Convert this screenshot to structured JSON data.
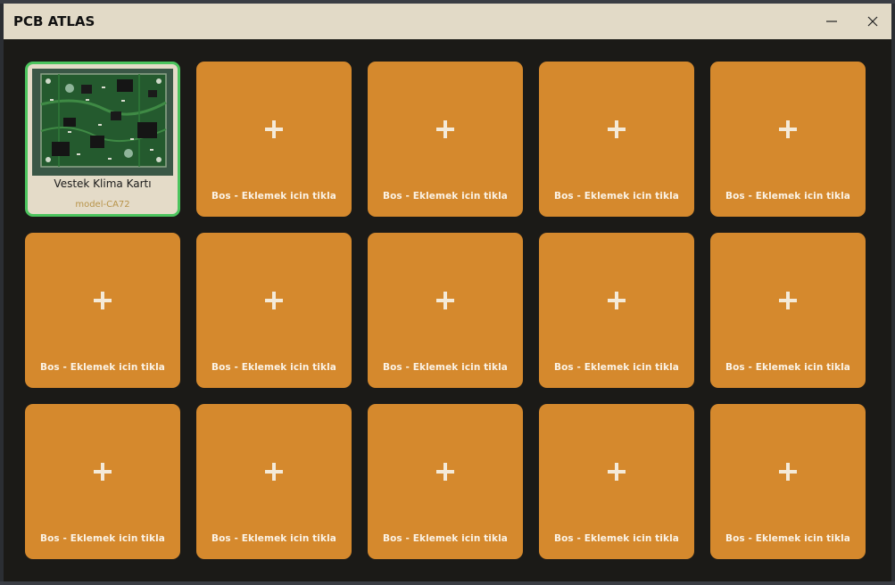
{
  "window": {
    "title": "PCB ATLAS",
    "minimize_icon": "minimize-icon",
    "close_icon": "close-icon"
  },
  "colors": {
    "titlebar": "#e2dac7",
    "background": "#1b1a17",
    "tile_empty": "#d5892d",
    "tile_filled": "#e4dbc8",
    "selected_border": "#4cc45e"
  },
  "cards": [
    {
      "filled": true,
      "name": "Vestek Klima Kartı",
      "model": "model-CA72",
      "image_icon": "pcb-board-image"
    },
    {
      "filled": false,
      "label": "Bos - Eklemek icin tikla"
    },
    {
      "filled": false,
      "label": "Bos - Eklemek icin tikla"
    },
    {
      "filled": false,
      "label": "Bos - Eklemek icin tikla"
    },
    {
      "filled": false,
      "label": "Bos - Eklemek icin tikla"
    },
    {
      "filled": false,
      "label": "Bos - Eklemek icin tikla"
    },
    {
      "filled": false,
      "label": "Bos - Eklemek icin tikla"
    },
    {
      "filled": false,
      "label": "Bos - Eklemek icin tikla"
    },
    {
      "filled": false,
      "label": "Bos - Eklemek icin tikla"
    },
    {
      "filled": false,
      "label": "Bos - Eklemek icin tikla"
    },
    {
      "filled": false,
      "label": "Bos - Eklemek icin tikla"
    },
    {
      "filled": false,
      "label": "Bos - Eklemek icin tikla"
    },
    {
      "filled": false,
      "label": "Bos - Eklemek icin tikla"
    },
    {
      "filled": false,
      "label": "Bos - Eklemek icin tikla"
    },
    {
      "filled": false,
      "label": "Bos - Eklemek icin tikla"
    }
  ]
}
